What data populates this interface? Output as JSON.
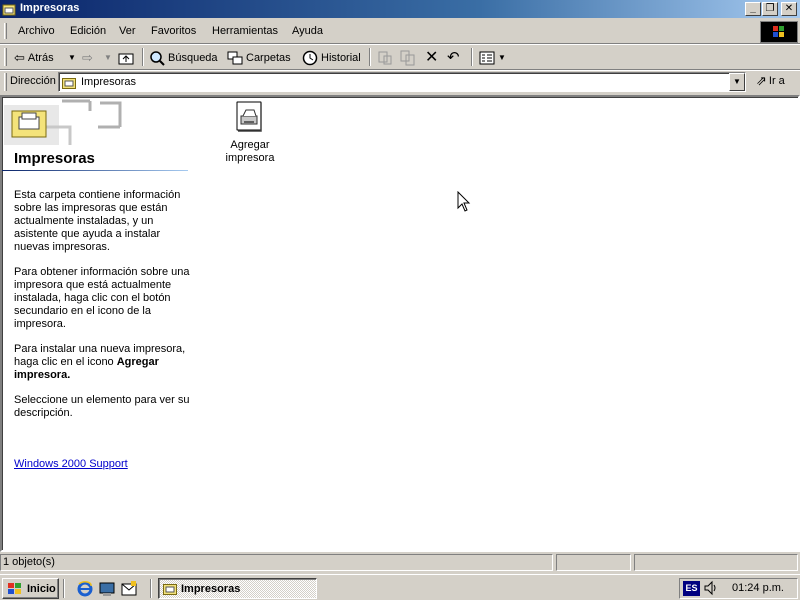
{
  "window": {
    "title": "Impresoras",
    "buttons": {
      "minimize": "_",
      "maximize": "❐",
      "close": "✕"
    }
  },
  "menubar": {
    "items": [
      "Archivo",
      "Edición",
      "Ver",
      "Favoritos",
      "Herramientas",
      "Ayuda"
    ]
  },
  "toolbar": {
    "back_label": "Atrás",
    "search_label": "Búsqueda",
    "folders_label": "Carpetas",
    "history_label": "Historial"
  },
  "address": {
    "label": "Dirección",
    "value": "Impresoras",
    "go_label": "Ir a"
  },
  "side": {
    "title": "Impresoras",
    "para1": "Esta carpeta contiene información sobre las impresoras que están actualmente instaladas, y un asistente que ayuda a instalar nuevas impresoras.",
    "para2": "Para obtener información sobre una impresora que está actualmente instalada, haga clic con el botón secundario en el icono de la impresora.",
    "para3_prefix": "Para instalar una nueva impresora, haga clic en el icono ",
    "para3_bold": "Agregar impresora.",
    "para4": "Seleccione un elemento para ver su descripción.",
    "link": "Windows 2000 Support"
  },
  "items": [
    {
      "label": "Agregar impresora",
      "icon": "add-printer-icon"
    }
  ],
  "statusbar": {
    "left": "1 objeto(s)"
  },
  "taskbar": {
    "start_label": "Inicio",
    "task_label": "Impresoras",
    "lang": "ES",
    "clock": "01:24 p.m."
  },
  "colors": {
    "title_gradient_start": "#0a246a",
    "title_gradient_end": "#a6caf0",
    "link": "#0000cc",
    "face": "#d4d0c8"
  }
}
